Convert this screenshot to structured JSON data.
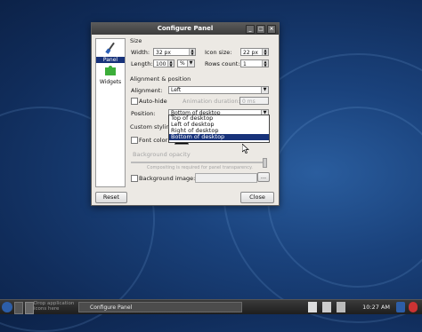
{
  "window": {
    "title": "Configure Panel"
  },
  "sidebar": {
    "items": [
      {
        "label": "Panel",
        "icon": "screwdriver-icon",
        "selected": true
      },
      {
        "label": "Widgets",
        "icon": "puzzle-icon",
        "selected": false
      }
    ]
  },
  "size_group": {
    "title": "Size",
    "width_label": "Width:",
    "width_value": "32 px",
    "icon_size_label": "Icon size:",
    "icon_size_value": "22 px",
    "length_label": "Length:",
    "length_value": "100",
    "length_unit": "%",
    "rows_label": "Rows count:",
    "rows_value": "1"
  },
  "alignment_group": {
    "title": "Alignment & position",
    "alignment_label": "Alignment:",
    "alignment_value": "Left",
    "autohide_label": "Auto-hide",
    "animation_label": "Animation duration:",
    "animation_value": "0 ms",
    "position_label": "Position:",
    "position_value": "Bottom of desktop",
    "position_options": [
      "Top of desktop",
      "Left of desktop",
      "Right of desktop",
      "Bottom of desktop"
    ],
    "position_highlight": "Bottom of desktop"
  },
  "styling_group": {
    "title": "Custom styling",
    "font_color_label": "Font color:",
    "bg_opacity_label": "Background opacity",
    "compositing_note": "Compositing is required for panel transparency.",
    "bg_image_label": "Background image:",
    "browse_label": "..."
  },
  "buttons": {
    "reset": "Reset",
    "close": "Close"
  },
  "taskbar": {
    "drop_text_1": "Drop application",
    "drop_text_2": "icons here",
    "task_label": "Configure Panel",
    "clock": "10:27 AM"
  },
  "colors": {
    "selection": "#17327a",
    "desktop": "#1a427c"
  }
}
